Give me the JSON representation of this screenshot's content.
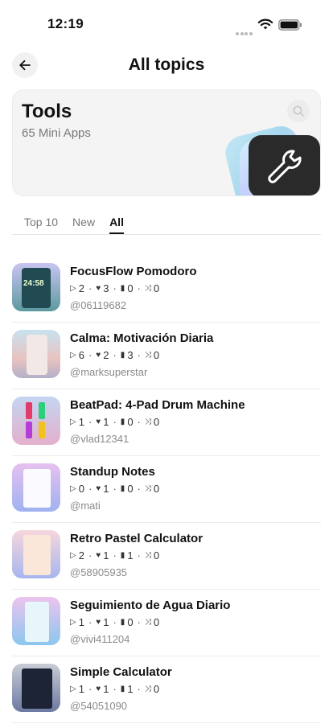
{
  "status": {
    "time": "12:19"
  },
  "header": {
    "title": "All topics"
  },
  "hero": {
    "title": "Tools",
    "subtitle": "65 Mini Apps"
  },
  "tabs": [
    {
      "label": "Top 10",
      "active": false
    },
    {
      "label": "New",
      "active": false
    },
    {
      "label": "All",
      "active": true
    }
  ],
  "items": [
    {
      "name": "FocusFlow Pomodoro",
      "plays": "2",
      "likes": "3",
      "saves": "0",
      "remixes": "0",
      "handle": "@06119682",
      "thumb_text": "24:58"
    },
    {
      "name": "Calma: Motivación Diaria",
      "plays": "6",
      "likes": "2",
      "saves": "3",
      "remixes": "0",
      "handle": "@marksuperstar"
    },
    {
      "name": "BeatPad: 4-Pad Drum Machine",
      "plays": "1",
      "likes": "1",
      "saves": "0",
      "remixes": "0",
      "handle": "@vlad12341"
    },
    {
      "name": "Standup Notes",
      "plays": "0",
      "likes": "1",
      "saves": "0",
      "remixes": "0",
      "handle": "@mati"
    },
    {
      "name": "Retro Pastel Calculator",
      "plays": "2",
      "likes": "1",
      "saves": "1",
      "remixes": "0",
      "handle": "@58905935"
    },
    {
      "name": "Seguimiento de Agua Diario",
      "plays": "1",
      "likes": "1",
      "saves": "0",
      "remixes": "0",
      "handle": "@vivi411204"
    },
    {
      "name": "Simple Calculator",
      "plays": "1",
      "likes": "1",
      "saves": "1",
      "remixes": "0",
      "handle": "@54051090"
    }
  ],
  "icons": {
    "back": "arrow-left-icon",
    "search": "search-icon",
    "category": "wrench-icon",
    "plays": "play-icon",
    "likes": "heart-icon",
    "saves": "bookmark-icon",
    "remixes": "shuffle-icon"
  }
}
